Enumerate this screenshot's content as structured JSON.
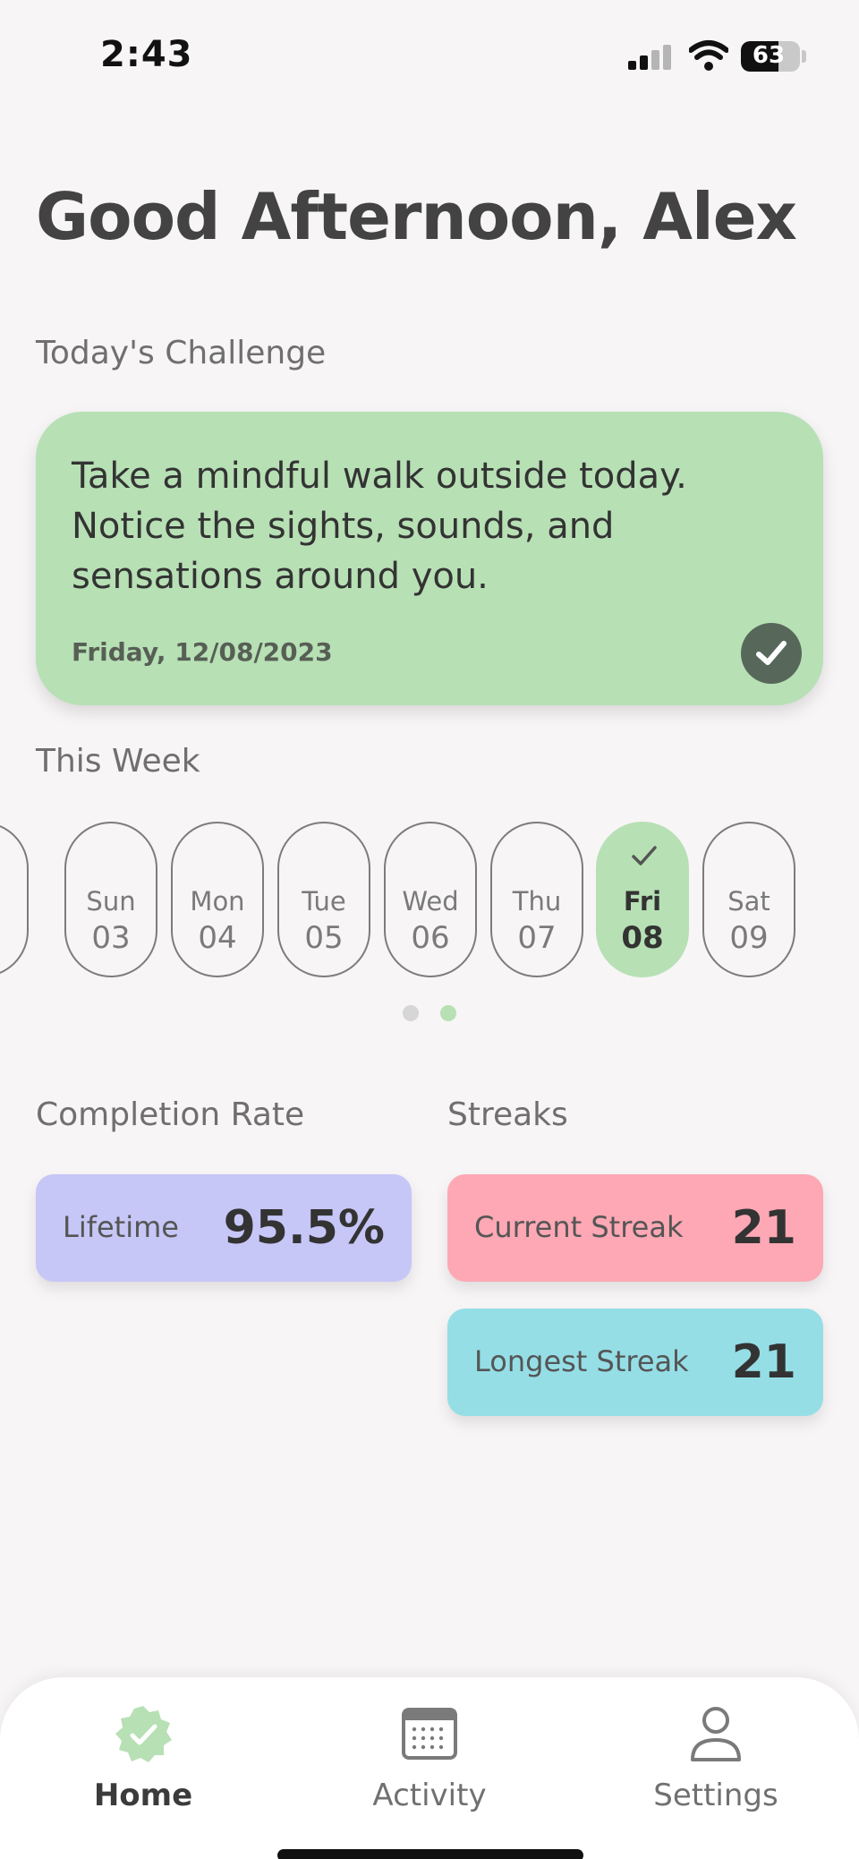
{
  "status_bar": {
    "time": "2:43",
    "battery": "63",
    "battery_level": 0.63
  },
  "greeting": "Good Afternoon, Alex",
  "challenge": {
    "section_label": "Today's Challenge",
    "text": "Take a mindful walk outside today. Notice the sights, sounds, and sensations around you.",
    "date": "Friday, 12/08/2023",
    "completed": true
  },
  "week": {
    "section_label": "This Week",
    "days": [
      {
        "name": "Sun",
        "num": "03",
        "active": false
      },
      {
        "name": "Mon",
        "num": "04",
        "active": false
      },
      {
        "name": "Tue",
        "num": "05",
        "active": false
      },
      {
        "name": "Wed",
        "num": "06",
        "active": false
      },
      {
        "name": "Thu",
        "num": "07",
        "active": false
      },
      {
        "name": "Fri",
        "num": "08",
        "active": true
      },
      {
        "name": "Sat",
        "num": "09",
        "active": false
      }
    ],
    "page_count": 2,
    "current_page": 2
  },
  "completion": {
    "section_label": "Completion Rate",
    "lifetime_label": "Lifetime",
    "lifetime_value": "95.5%"
  },
  "streaks": {
    "section_label": "Streaks",
    "current_label": "Current Streak",
    "current_value": "21",
    "longest_label": "Longest Streak",
    "longest_value": "21"
  },
  "tabs": [
    {
      "label": "Home",
      "icon": "badge-check-icon",
      "active": true
    },
    {
      "label": "Activity",
      "icon": "calendar-icon",
      "active": false
    },
    {
      "label": "Settings",
      "icon": "person-icon",
      "active": false
    }
  ],
  "colors": {
    "accent_green": "#b7e0b5",
    "check_dark": "#57685a",
    "lifetime_card": "#c6c6f7",
    "current_streak_card": "#fda8b4",
    "longest_streak_card": "#95dee6"
  }
}
